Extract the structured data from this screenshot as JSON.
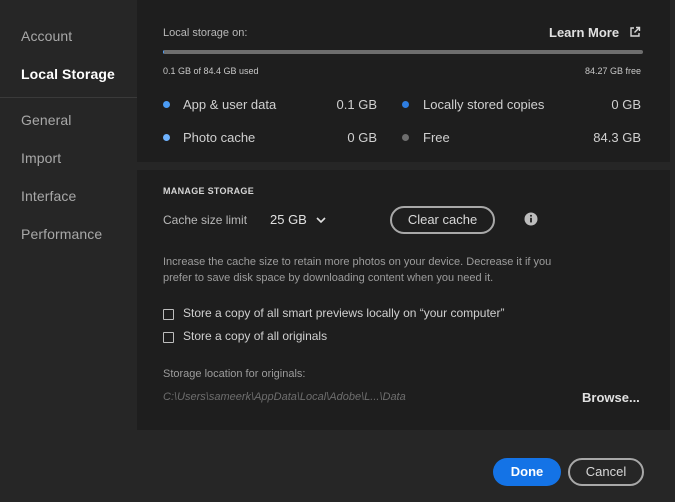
{
  "sidebar": {
    "items": [
      {
        "label": "Account"
      },
      {
        "label": "Local Storage"
      },
      {
        "label": "General"
      },
      {
        "label": "Import"
      },
      {
        "label": "Interface"
      },
      {
        "label": "Performance"
      }
    ]
  },
  "storage": {
    "title": "Local storage on:",
    "learn_more": "Learn More",
    "used_text": "0.1 GB of 84.4 GB used",
    "free_text": "84.27 GB free",
    "used_fraction": 0.0015,
    "legend": [
      {
        "label": "App & user data",
        "value": "0.1 GB",
        "color": "#4b9cf5"
      },
      {
        "label": "Locally stored copies",
        "value": "0 GB",
        "color": "#2e7de0"
      },
      {
        "label": "Photo cache",
        "value": "0 GB",
        "color": "#6fb3ff"
      },
      {
        "label": "Free",
        "value": "84.3 GB",
        "color": "#6e6e6e"
      }
    ]
  },
  "manage": {
    "heading": "MANAGE STORAGE",
    "cache_label": "Cache size limit",
    "cache_value": "25 GB",
    "clear_cache": "Clear cache",
    "description": "Increase the cache size to retain more photos on your device. Decrease it if you prefer to save disk space by downloading content when you need it.",
    "checkbox_previews": "Store a copy of all smart previews locally on “your computer”",
    "checkbox_originals": "Store a copy of all originals",
    "location_label": "Storage location for originals:",
    "location_path": "C:\\Users\\sameerk\\AppData\\Local\\Adobe\\L...\\Data",
    "browse": "Browse..."
  },
  "footer": {
    "done": "Done",
    "cancel": "Cancel"
  },
  "icons": {
    "external_link": "external-link-icon",
    "chevron": "chevron-down-icon",
    "info": "info-icon"
  }
}
